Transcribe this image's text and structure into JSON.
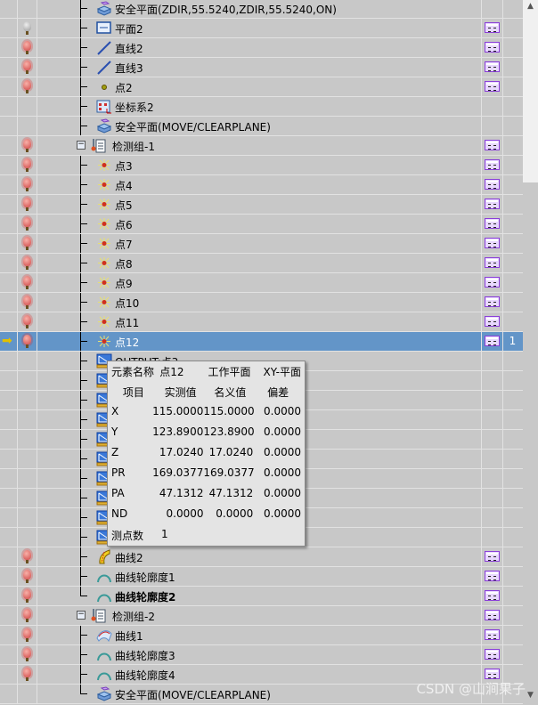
{
  "rows": [
    {
      "label": "安全平面(ZDIR,55.5240,ZDIR,55.5240,ON)",
      "icon": "safe-plane",
      "bulb": "none",
      "report": false
    },
    {
      "label": "平面2",
      "icon": "plane",
      "bulb": "off",
      "report": true
    },
    {
      "label": "直线2",
      "icon": "line",
      "bulb": "on",
      "report": true
    },
    {
      "label": "直线3",
      "icon": "line",
      "bulb": "on",
      "report": true
    },
    {
      "label": "点2",
      "icon": "point",
      "bulb": "on",
      "report": true
    },
    {
      "label": "坐标系2",
      "icon": "coordinate-system",
      "bulb": "none",
      "report": false
    },
    {
      "label": "安全平面(MOVE/CLEARPLANE)",
      "icon": "safe-plane",
      "bulb": "none",
      "report": false
    },
    {
      "label": "检测组-1",
      "icon": "group",
      "bulb": "on",
      "report": true,
      "group": true
    },
    {
      "label": "点3",
      "icon": "point-measured",
      "bulb": "on",
      "report": true
    },
    {
      "label": "点4",
      "icon": "point-measured",
      "bulb": "on",
      "report": true
    },
    {
      "label": "点5",
      "icon": "point-measured",
      "bulb": "on",
      "report": true
    },
    {
      "label": "点6",
      "icon": "point-measured",
      "bulb": "on",
      "report": true
    },
    {
      "label": "点7",
      "icon": "point-measured",
      "bulb": "on",
      "report": true
    },
    {
      "label": "点8",
      "icon": "point-measured",
      "bulb": "on",
      "report": true
    },
    {
      "label": "点9",
      "icon": "point-measured",
      "bulb": "on",
      "report": true
    },
    {
      "label": "点10",
      "icon": "point-measured",
      "bulb": "on",
      "report": true
    },
    {
      "label": "点11",
      "icon": "point-measured",
      "bulb": "on",
      "report": true
    },
    {
      "label": "点12",
      "icon": "point-measured",
      "bulb": "on",
      "report": true,
      "selected": true,
      "count": "1"
    },
    {
      "label": "OUTPUT:点3",
      "icon": "output",
      "bulb": "none",
      "report": false
    },
    {
      "label": "OUTPUT",
      "icon": "output",
      "bulb": "none",
      "report": false
    },
    {
      "label": "OUTPUT",
      "icon": "output",
      "bulb": "none",
      "report": false
    },
    {
      "label": "OUTPUT",
      "icon": "output",
      "bulb": "none",
      "report": false
    },
    {
      "label": "OUTPUT",
      "icon": "output",
      "bulb": "none",
      "report": false
    },
    {
      "label": "OUTPUT",
      "icon": "output",
      "bulb": "none",
      "report": false
    },
    {
      "label": "OUTPUT",
      "icon": "output",
      "bulb": "none",
      "report": false
    },
    {
      "label": "OUTPUT",
      "icon": "output",
      "bulb": "none",
      "report": false
    },
    {
      "label": "OUTPUT",
      "icon": "output",
      "bulb": "none",
      "report": false
    },
    {
      "label": "OUTPUT",
      "icon": "output",
      "bulb": "none",
      "report": false
    },
    {
      "label": "曲线2",
      "icon": "curve",
      "bulb": "on",
      "report": true
    },
    {
      "label": "曲线轮廓度1",
      "icon": "profile",
      "bulb": "on",
      "report": true
    },
    {
      "label": "曲线轮廓度2",
      "icon": "profile",
      "bulb": "on",
      "report": true,
      "bold": true,
      "last": true
    },
    {
      "label": "检测组-2",
      "icon": "group",
      "bulb": "on",
      "report": true,
      "group": true
    },
    {
      "label": "曲线1",
      "icon": "curve-surface",
      "bulb": "on",
      "report": true
    },
    {
      "label": "曲线轮廓度3",
      "icon": "profile",
      "bulb": "on",
      "report": true
    },
    {
      "label": "曲线轮廓度4",
      "icon": "profile",
      "bulb": "on",
      "report": true
    },
    {
      "label": "安全平面(MOVE/CLEARPLANE)",
      "icon": "safe-plane",
      "bulb": "none",
      "report": false,
      "last": true
    }
  ],
  "tooltip": {
    "name_label": "元素名称",
    "name_value": "点12",
    "plane_label": "工作平面",
    "plane_value": "XY-平面",
    "headers": [
      "项目",
      "实测值",
      "名义值",
      "偏差"
    ],
    "rows": [
      [
        "X",
        "115.0000",
        "115.0000",
        "0.0000"
      ],
      [
        "Y",
        "123.8900",
        "123.8900",
        "0.0000"
      ],
      [
        "Z",
        "17.0240",
        "17.0240",
        "0.0000"
      ],
      [
        "PR",
        "169.0377",
        "169.0377",
        "0.0000"
      ],
      [
        "PA",
        "47.1312",
        "47.1312",
        "0.0000"
      ],
      [
        "ND",
        "0.0000",
        "0.0000",
        "0.0000"
      ]
    ],
    "points_label": "测点数",
    "points_value": "1"
  },
  "watermark": "CSDN @山涧果子",
  "colors": {
    "selection": "#6395c8",
    "background": "#c8c8c8"
  }
}
